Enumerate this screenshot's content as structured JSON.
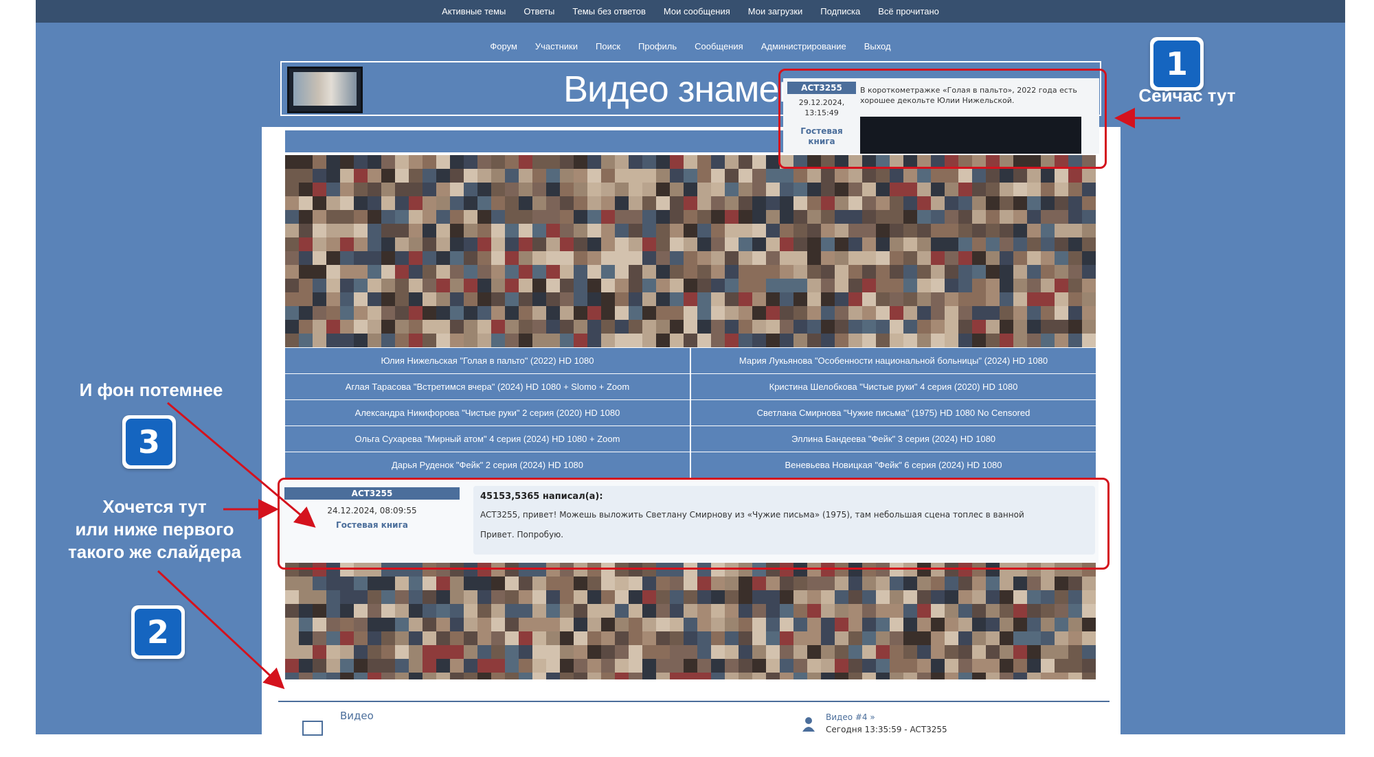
{
  "top_nav": [
    "Активные темы",
    "Ответы",
    "Темы без ответов",
    "Мои сообщения",
    "Мои загрузки",
    "Подписка",
    "Всё прочитано"
  ],
  "sec_nav": [
    "Форум",
    "Участники",
    "Поиск",
    "Профиль",
    "Сообщения",
    "Администрирование",
    "Выход"
  ],
  "banner": {
    "title": "Видео знаменито"
  },
  "popup": {
    "username": "ACT3255",
    "date": "29.12.2024,",
    "time": "13:15:49",
    "guestbook_line1": "Гостевая",
    "guestbook_line2": "книга",
    "text_line1": "В короткометражке «Голая в пальто», 2022 года есть",
    "text_line2": "хорошее декольте Юлии Нижельской."
  },
  "video_links": [
    [
      "Юлия Нижельская \"Голая в пальто\" (2022) HD 1080",
      "Мария Лукьянова \"Особенности национальной больницы\" (2024) HD 1080"
    ],
    [
      "Аглая Тарасова \"Встретимся вчера\" (2024) HD 1080 + Slomo + Zoom",
      "Кристина Шелобкова \"Чистые руки\" 4 серия (2020) HD 1080"
    ],
    [
      "Александра Никифорова \"Чистые руки\" 2 серия (2020) HD 1080",
      "Светлана Смирнова \"Чужие письма\" (1975) HD 1080 No Censored"
    ],
    [
      "Ольга Сухарева \"Мирный атом\" 4 серия (2024) HD 1080 + Zoom",
      "Эллина Бандеева \"Фейк\" 3 серия (2024) HD 1080"
    ],
    [
      "Дарья Руденок \"Фейк\" 2 серия (2024) HD 1080",
      "Веневьева Новицкая \"Фейк\" 6 серия (2024) HD 1080"
    ]
  ],
  "post": {
    "username": "ACT3255",
    "date": "24.12.2024, 08:09:55",
    "guestbook": "Гостевая книга",
    "author": "45153,5365 написал(а):",
    "text": "ACT3255, привет! Можешь выложить Светлану Смирнову из «Чужие письма» (1975), там небольшая сцена топлес в ванной",
    "reply": "Привет. Попробую."
  },
  "annotations": {
    "label1": "Сейчас тут",
    "label3": "И фон потемнее",
    "label2_line1": "Хочется тут",
    "label2_line2": "или ниже первого",
    "label2_line3": "такого же слайдера",
    "badge1": "1",
    "badge2": "2",
    "badge3": "3"
  },
  "bottom": {
    "section": "Видео",
    "last_topic": "Видео #4 »",
    "last_meta": "Сегодня 13:35:59 - ACT3255"
  },
  "colors": {
    "frame_bg": "#5a83b8",
    "topnav_bg": "#37506f",
    "highlight": "#d4121d",
    "badge": "#1565c0"
  }
}
